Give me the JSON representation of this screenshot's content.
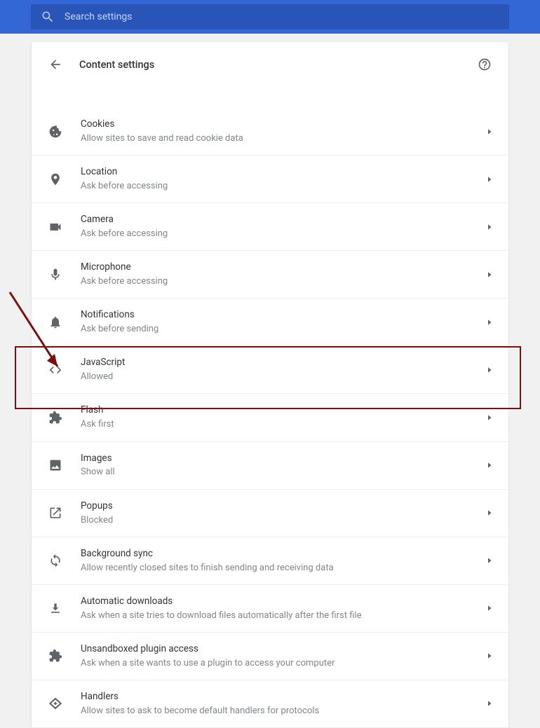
{
  "search": {
    "placeholder": "Search settings"
  },
  "header": {
    "title": "Content settings"
  },
  "rows": [
    {
      "icon": "cookie",
      "title": "Cookies",
      "sub": "Allow sites to save and read cookie data"
    },
    {
      "icon": "location",
      "title": "Location",
      "sub": "Ask before accessing"
    },
    {
      "icon": "camera",
      "title": "Camera",
      "sub": "Ask before accessing"
    },
    {
      "icon": "mic",
      "title": "Microphone",
      "sub": "Ask before accessing"
    },
    {
      "icon": "bell",
      "title": "Notifications",
      "sub": "Ask before sending"
    },
    {
      "icon": "code",
      "title": "JavaScript",
      "sub": "Allowed"
    },
    {
      "icon": "puzzle",
      "title": "Flash",
      "sub": "Ask first"
    },
    {
      "icon": "image",
      "title": "Images",
      "sub": "Show all"
    },
    {
      "icon": "external",
      "title": "Popups",
      "sub": "Blocked"
    },
    {
      "icon": "sync",
      "title": "Background sync",
      "sub": "Allow recently closed sites to finish sending and receiving data"
    },
    {
      "icon": "download",
      "title": "Automatic downloads",
      "sub": "Ask when a site tries to download files automatically after the first file"
    },
    {
      "icon": "puzzle",
      "title": "Unsandboxed plugin access",
      "sub": "Ask when a site wants to use a plugin to access your computer"
    },
    {
      "icon": "handlers",
      "title": "Handlers",
      "sub": "Allow sites to ask to become default handlers for protocols"
    }
  ]
}
